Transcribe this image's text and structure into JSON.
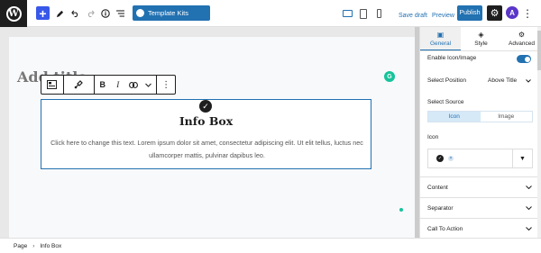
{
  "topbar": {
    "template_kits_label": "Template Kits",
    "save_draft_label": "Save draft",
    "preview_label": "Preview",
    "publish_label": "Publish"
  },
  "editor": {
    "post_title_placeholder": "Add title",
    "infobox": {
      "title": "Info Box",
      "description": "Click here to change this text. Lorem ipsum dolor sit amet, consectetur adipiscing elit. Ut elit tellus, luctus nec ullamcorper mattis, pulvinar dapibus leo."
    }
  },
  "sidebar": {
    "tabs": [
      {
        "label": "General",
        "icon": "general-icon",
        "active": true
      },
      {
        "label": "Style",
        "icon": "paint-icon",
        "active": false
      },
      {
        "label": "Advanced",
        "icon": "gear-icon",
        "active": false
      }
    ],
    "enable_icon_label": "Enable Icon/Image",
    "enable_icon_on": true,
    "select_position_label": "Select Position",
    "select_position_value": "Above Title",
    "select_source_label": "Select Source",
    "source_options": [
      "Icon",
      "Image"
    ],
    "source_selected": "Icon",
    "icon_label": "Icon",
    "panels": [
      "Content",
      "Separator",
      "Call To Action"
    ]
  },
  "footer": {
    "breadcrumb": [
      "Page",
      "Info Box"
    ]
  },
  "colors": {
    "accent": "#2271b1",
    "add_button": "#3858e9",
    "astra": "#5b36c9",
    "grammarly": "#15c39a"
  }
}
